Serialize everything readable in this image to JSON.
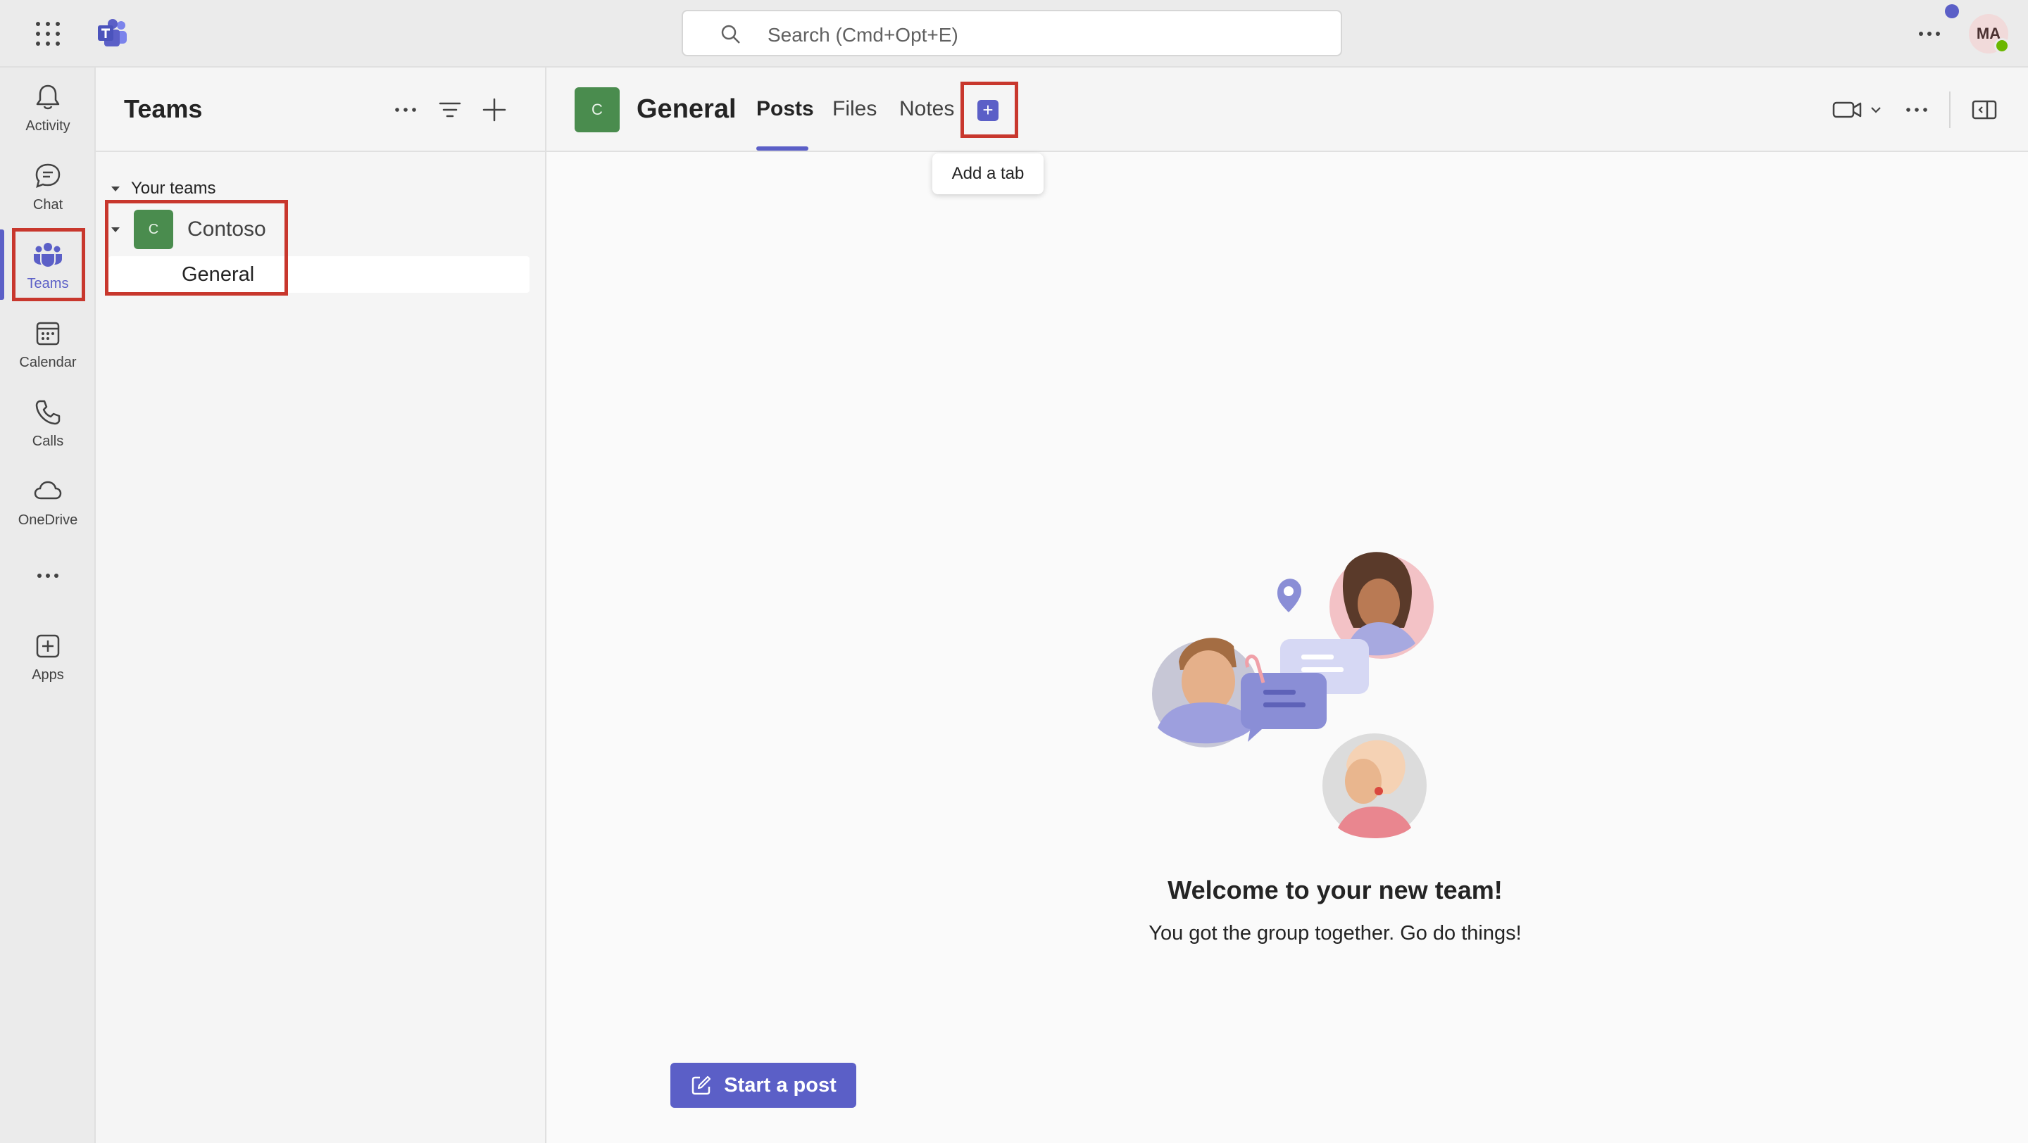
{
  "topbar": {
    "search_placeholder": "Search (Cmd+Opt+E)",
    "avatar_initials": "MA"
  },
  "rail": {
    "items": [
      {
        "label": "Activity",
        "icon": "bell-icon"
      },
      {
        "label": "Chat",
        "icon": "chat-icon"
      },
      {
        "label": "Teams",
        "icon": "teams-icon",
        "active": true
      },
      {
        "label": "Calendar",
        "icon": "calendar-icon"
      },
      {
        "label": "Calls",
        "icon": "phone-icon"
      },
      {
        "label": "OneDrive",
        "icon": "cloud-icon"
      },
      {
        "label": "",
        "icon": "more-icon"
      },
      {
        "label": "Apps",
        "icon": "add-app-icon"
      }
    ]
  },
  "teams_pane": {
    "title": "Teams",
    "section_label": "Your teams",
    "team": {
      "initial": "C",
      "name": "Contoso"
    },
    "channel": "General"
  },
  "channel": {
    "avatar_initial": "C",
    "title": "General",
    "tabs": [
      "Posts",
      "Files",
      "Notes"
    ],
    "active_tab": "Posts",
    "add_tab_tooltip": "Add a tab"
  },
  "welcome": {
    "title": "Welcome to your new team!",
    "subtitle": "You got the group together. Go do things!"
  },
  "compose": {
    "start_post_label": "Start a post"
  },
  "colors": {
    "accent": "#5b5fc7",
    "team_avatar": "#4a8c4e",
    "highlight_box": "#c8372d",
    "presence": "#6bb700"
  }
}
